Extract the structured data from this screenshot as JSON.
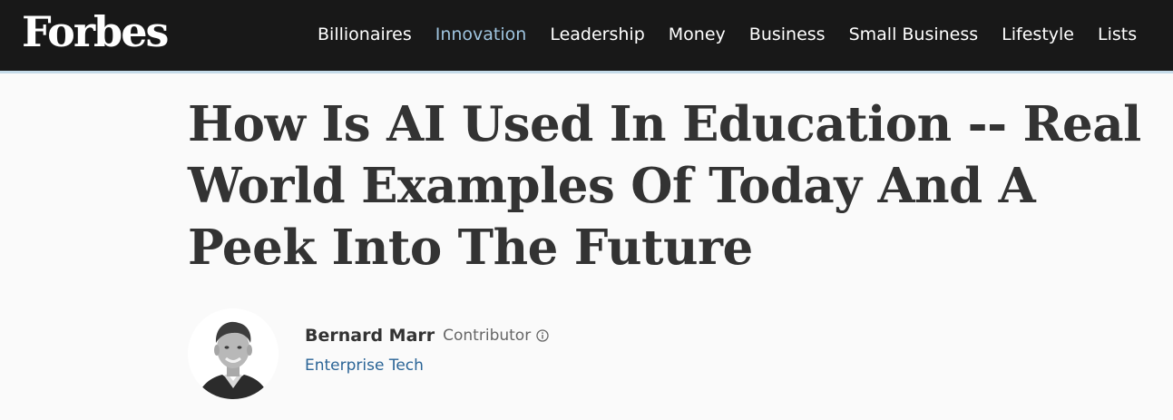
{
  "header": {
    "logo": "Forbes",
    "nav": [
      {
        "label": "Billionaires",
        "active": false
      },
      {
        "label": "Innovation",
        "active": true
      },
      {
        "label": "Leadership",
        "active": false
      },
      {
        "label": "Money",
        "active": false
      },
      {
        "label": "Business",
        "active": false
      },
      {
        "label": "Small Business",
        "active": false
      },
      {
        "label": "Lifestyle",
        "active": false
      },
      {
        "label": "Lists",
        "active": false
      }
    ]
  },
  "article": {
    "headline": "How Is AI Used In Education -- Real World Examples Of Today And A Peek Into The Future"
  },
  "byline": {
    "author": "Bernard Marr",
    "role": "Contributor",
    "channel": "Enterprise Tech",
    "icons": [
      "info-icon"
    ]
  },
  "colors": {
    "header_bg": "#181818",
    "active_nav": "#9fc4df",
    "channel_link": "#2a6496",
    "headline": "#333333"
  }
}
